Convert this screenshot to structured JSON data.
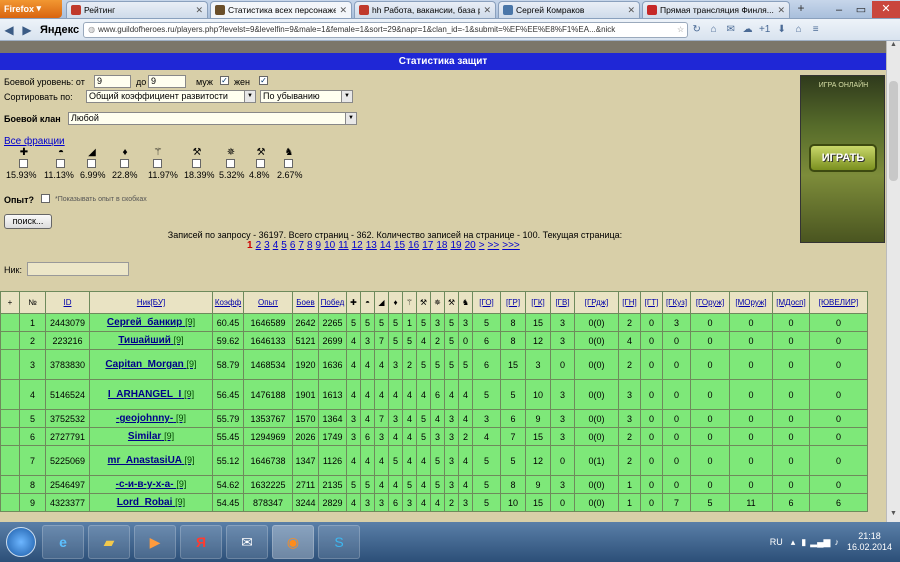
{
  "browser": {
    "app_button": "Firefox",
    "tabs": [
      {
        "label": "Рейтинг",
        "color": "#c0392b",
        "active": false
      },
      {
        "label": "Статистика всех персонаже...",
        "color": "#6b4f2a",
        "active": true
      },
      {
        "label": "hh Работа, вакансии, база рез...",
        "color": "#c0392b",
        "active": false
      },
      {
        "label": "Сергей Комраков",
        "color": "#4a76a8",
        "active": false
      },
      {
        "label": "Прямая трансляция Финля...",
        "color": "#c62828",
        "active": false
      }
    ],
    "new_tab": "+",
    "search_brand": "Яндекс",
    "url": "www.guildofheroes.ru/players.php?levelst=9&levelfin=9&male=1&female=1&sort=29&napr=1&clan_id=-1&submit=%EF%EE%E8%F1%EA...&nick"
  },
  "page": {
    "top_strip": "",
    "title": "Статистика защит",
    "level_label": "Боевой уровень: от",
    "level_from": "9",
    "level_to_label": "до",
    "level_to": "9",
    "male_label": "муж",
    "female_label": "жен",
    "sort_label": "Сортировать по:",
    "sort_value": "Общий коэффициент развитости",
    "order_value": "По убыванию",
    "clan_label": "Боевой клан",
    "clan_value": "Любой",
    "all_factions": "Все фракции",
    "factions": [
      {
        "icon": "cross-icon",
        "glyph": "✚",
        "pct": "15.93%"
      },
      {
        "icon": "helmet-icon",
        "glyph": "◓",
        "pct": "11.13%"
      },
      {
        "icon": "wizard-hat-icon",
        "glyph": "◢",
        "pct": "6.99%"
      },
      {
        "icon": "leaf-icon",
        "glyph": "♦",
        "pct": "22.8%"
      },
      {
        "icon": "staff-icon",
        "glyph": "⚚",
        "pct": "11.97%"
      },
      {
        "icon": "scythe-icon",
        "glyph": "⚒",
        "pct": "18.39%"
      },
      {
        "icon": "demon-star-icon",
        "glyph": "✵",
        "pct": "5.32%"
      },
      {
        "icon": "hammer-icon",
        "glyph": "⚒",
        "pct": "4.8%"
      },
      {
        "icon": "wolf-icon",
        "glyph": "♞",
        "pct": "2.67%"
      }
    ],
    "exp_label": "Опыт?",
    "exp_hint": "*Показывать опыт в скобках",
    "search_button": "поиск...",
    "summary": "Записей по запросу - 36197. Всего страниц - 362. Количество записей на странице - 100. Текущая страница:",
    "pages": [
      "1",
      "2",
      "3",
      "4",
      "5",
      "6",
      "7",
      "8",
      "9",
      "10",
      "11",
      "12",
      "13",
      "14",
      "15",
      "16",
      "17",
      "18",
      "19",
      "20",
      ">",
      ">>",
      ">>>"
    ],
    "nick_label": "Ник:",
    "ad_button": "ИГРАТЬ",
    "ad_top": "ИГРА ОНЛАЙН"
  },
  "table": {
    "headers": [
      "+",
      "№",
      "ID",
      "Ник[БУ]",
      "Коэфф",
      "Опыт",
      "Боев",
      "Побед",
      "✚",
      "◓",
      "◢",
      "♦",
      "⚚",
      "⚒",
      "✵",
      "⚒",
      "♞",
      "[ГО]",
      "[ГР]",
      "[ГК]",
      "[ГВ]",
      "[ГРдж]",
      "[ГН]",
      "[ГТ]",
      "[ГКуз]",
      "[ГОруж]",
      "[МОруж]",
      "[МДосп]",
      "[ЮВЕЛИР]"
    ],
    "rows": [
      {
        "n": "1",
        "id": "2443079",
        "nick": "Сергей_банкир",
        "lv": "[9]",
        "vals": [
          "60.45",
          "1646589",
          "2642",
          "2265",
          "5",
          "5",
          "5",
          "5",
          "1",
          "5",
          "3",
          "5",
          "3",
          "5",
          "8",
          "15",
          "3",
          "0(0)",
          "2",
          "0",
          "3",
          "0",
          "0",
          "0",
          "0"
        ]
      },
      {
        "n": "2",
        "id": "223216",
        "nick": "Тишайший",
        "lv": "[9]",
        "vals": [
          "59.62",
          "1646133",
          "5121",
          "2699",
          "4",
          "3",
          "7",
          "5",
          "5",
          "4",
          "2",
          "5",
          "0",
          "6",
          "8",
          "12",
          "3",
          "0(0)",
          "4",
          "0",
          "0",
          "0",
          "0",
          "0",
          "0"
        ]
      },
      {
        "n": "3",
        "id": "3783830",
        "nick": "Capitan_Morgan",
        "lv": "[9]",
        "vals": [
          "58.79",
          "1468534",
          "1920",
          "1636",
          "4",
          "4",
          "4",
          "3",
          "2",
          "5",
          "5",
          "5",
          "5",
          "6",
          "15",
          "3",
          "0",
          "0(0)",
          "2",
          "0",
          "0",
          "0",
          "0",
          "0",
          "0"
        ]
      },
      {
        "n": "4",
        "id": "5146524",
        "nick": "I_ARHANGEL_I",
        "lv": "[9]",
        "vals": [
          "56.45",
          "1476188",
          "1901",
          "1613",
          "4",
          "4",
          "4",
          "4",
          "4",
          "4",
          "6",
          "4",
          "4",
          "5",
          "5",
          "10",
          "3",
          "0(0)",
          "3",
          "0",
          "0",
          "0",
          "0",
          "0",
          "0"
        ]
      },
      {
        "n": "5",
        "id": "3752532",
        "nick": "-geojohnny-",
        "lv": "[9]",
        "vals": [
          "55.79",
          "1353767",
          "1570",
          "1364",
          "3",
          "4",
          "7",
          "3",
          "4",
          "5",
          "4",
          "3",
          "4",
          "3",
          "6",
          "9",
          "3",
          "0(0)",
          "3",
          "0",
          "0",
          "0",
          "0",
          "0",
          "0"
        ]
      },
      {
        "n": "6",
        "id": "2727791",
        "nick": "Similar",
        "lv": "[9]",
        "vals": [
          "55.45",
          "1294969",
          "2026",
          "1749",
          "3",
          "6",
          "3",
          "4",
          "4",
          "5",
          "3",
          "3",
          "2",
          "4",
          "7",
          "15",
          "3",
          "0(0)",
          "2",
          "0",
          "0",
          "0",
          "0",
          "0",
          "0"
        ]
      },
      {
        "n": "7",
        "id": "5225069",
        "nick": "mr_AnastasiUA",
        "lv": "[9]",
        "vals": [
          "55.12",
          "1646738",
          "1347",
          "1126",
          "4",
          "4",
          "4",
          "5",
          "4",
          "4",
          "5",
          "3",
          "4",
          "5",
          "5",
          "12",
          "0",
          "0(1)",
          "2",
          "0",
          "0",
          "0",
          "0",
          "0",
          "0"
        ]
      },
      {
        "n": "8",
        "id": "2546497",
        "nick": "-с-и-в-у-х-а-",
        "lv": "[9]",
        "vals": [
          "54.62",
          "1632225",
          "2711",
          "2135",
          "5",
          "5",
          "4",
          "4",
          "5",
          "4",
          "5",
          "3",
          "4",
          "5",
          "8",
          "9",
          "3",
          "0(0)",
          "1",
          "0",
          "0",
          "0",
          "0",
          "0",
          "0"
        ]
      },
      {
        "n": "9",
        "id": "4323377",
        "nick": "Lord_Robai",
        "lv": "[9]",
        "vals": [
          "54.45",
          "878347",
          "3244",
          "2829",
          "4",
          "3",
          "3",
          "6",
          "3",
          "4",
          "4",
          "2",
          "3",
          "5",
          "10",
          "15",
          "0",
          "0(0)",
          "1",
          "0",
          "7",
          "5",
          "11",
          "6",
          "6"
        ]
      }
    ]
  },
  "taskbar": {
    "lang": "RU",
    "time": "21:18",
    "date": "16.02.2014"
  }
}
